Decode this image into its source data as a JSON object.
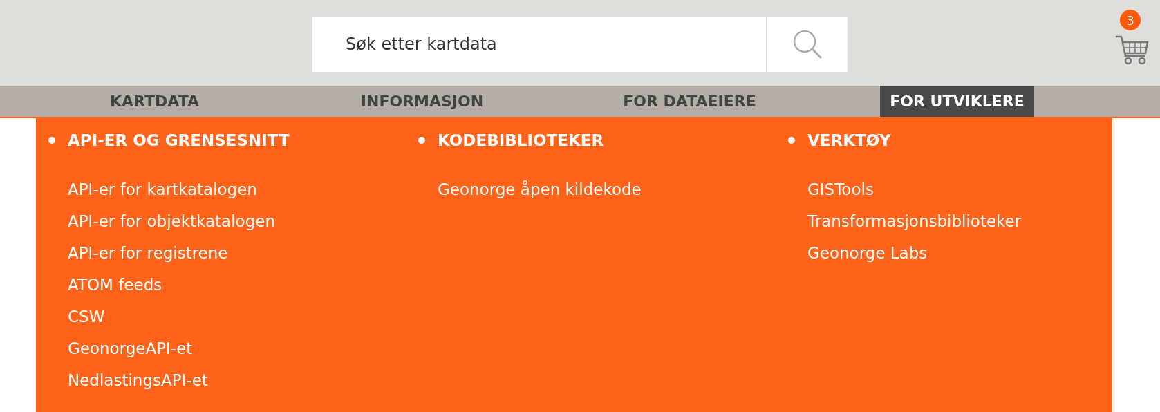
{
  "search": {
    "placeholder": "Søk etter kartdata"
  },
  "cart": {
    "count": "3"
  },
  "nav": [
    {
      "label": "KARTDATA",
      "selected": false
    },
    {
      "label": "INFORMASJON",
      "selected": false
    },
    {
      "label": "FOR DATAEIERE",
      "selected": false
    },
    {
      "label": "FOR UTVIKLERE",
      "selected": true
    }
  ],
  "menu": {
    "columns": [
      {
        "heading": "API-ER OG GRENSESNITT",
        "items": [
          "API-er for kartkatalogen",
          "API-er for objektkatalogen",
          "API-er for registrene",
          "ATOM feeds",
          "CSW",
          "GeonorgeAPI-et",
          "NedlastingsAPI-et"
        ]
      },
      {
        "heading": "KODEBIBLIOTEKER",
        "items": [
          "Geonorge åpen kildekode"
        ]
      },
      {
        "heading": "VERKTØY",
        "items": [
          "GISTools",
          "Transformasjonsbiblioteker",
          "Geonorge Labs"
        ]
      }
    ]
  }
}
